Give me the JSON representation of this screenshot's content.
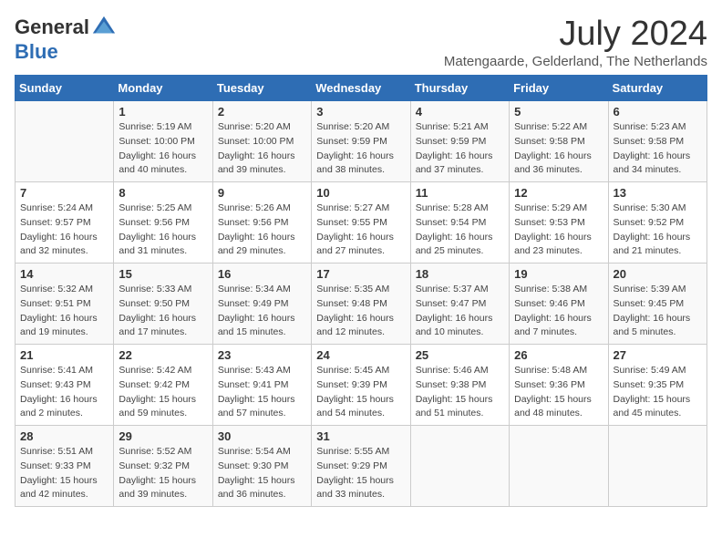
{
  "logo": {
    "general": "General",
    "blue": "Blue"
  },
  "title": "July 2024",
  "location": "Matengaarde, Gelderland, The Netherlands",
  "days_of_week": [
    "Sunday",
    "Monday",
    "Tuesday",
    "Wednesday",
    "Thursday",
    "Friday",
    "Saturday"
  ],
  "weeks": [
    [
      {
        "day": "",
        "info": ""
      },
      {
        "day": "1",
        "info": "Sunrise: 5:19 AM\nSunset: 10:00 PM\nDaylight: 16 hours\nand 40 minutes."
      },
      {
        "day": "2",
        "info": "Sunrise: 5:20 AM\nSunset: 10:00 PM\nDaylight: 16 hours\nand 39 minutes."
      },
      {
        "day": "3",
        "info": "Sunrise: 5:20 AM\nSunset: 9:59 PM\nDaylight: 16 hours\nand 38 minutes."
      },
      {
        "day": "4",
        "info": "Sunrise: 5:21 AM\nSunset: 9:59 PM\nDaylight: 16 hours\nand 37 minutes."
      },
      {
        "day": "5",
        "info": "Sunrise: 5:22 AM\nSunset: 9:58 PM\nDaylight: 16 hours\nand 36 minutes."
      },
      {
        "day": "6",
        "info": "Sunrise: 5:23 AM\nSunset: 9:58 PM\nDaylight: 16 hours\nand 34 minutes."
      }
    ],
    [
      {
        "day": "7",
        "info": "Sunrise: 5:24 AM\nSunset: 9:57 PM\nDaylight: 16 hours\nand 32 minutes."
      },
      {
        "day": "8",
        "info": "Sunrise: 5:25 AM\nSunset: 9:56 PM\nDaylight: 16 hours\nand 31 minutes."
      },
      {
        "day": "9",
        "info": "Sunrise: 5:26 AM\nSunset: 9:56 PM\nDaylight: 16 hours\nand 29 minutes."
      },
      {
        "day": "10",
        "info": "Sunrise: 5:27 AM\nSunset: 9:55 PM\nDaylight: 16 hours\nand 27 minutes."
      },
      {
        "day": "11",
        "info": "Sunrise: 5:28 AM\nSunset: 9:54 PM\nDaylight: 16 hours\nand 25 minutes."
      },
      {
        "day": "12",
        "info": "Sunrise: 5:29 AM\nSunset: 9:53 PM\nDaylight: 16 hours\nand 23 minutes."
      },
      {
        "day": "13",
        "info": "Sunrise: 5:30 AM\nSunset: 9:52 PM\nDaylight: 16 hours\nand 21 minutes."
      }
    ],
    [
      {
        "day": "14",
        "info": "Sunrise: 5:32 AM\nSunset: 9:51 PM\nDaylight: 16 hours\nand 19 minutes."
      },
      {
        "day": "15",
        "info": "Sunrise: 5:33 AM\nSunset: 9:50 PM\nDaylight: 16 hours\nand 17 minutes."
      },
      {
        "day": "16",
        "info": "Sunrise: 5:34 AM\nSunset: 9:49 PM\nDaylight: 16 hours\nand 15 minutes."
      },
      {
        "day": "17",
        "info": "Sunrise: 5:35 AM\nSunset: 9:48 PM\nDaylight: 16 hours\nand 12 minutes."
      },
      {
        "day": "18",
        "info": "Sunrise: 5:37 AM\nSunset: 9:47 PM\nDaylight: 16 hours\nand 10 minutes."
      },
      {
        "day": "19",
        "info": "Sunrise: 5:38 AM\nSunset: 9:46 PM\nDaylight: 16 hours\nand 7 minutes."
      },
      {
        "day": "20",
        "info": "Sunrise: 5:39 AM\nSunset: 9:45 PM\nDaylight: 16 hours\nand 5 minutes."
      }
    ],
    [
      {
        "day": "21",
        "info": "Sunrise: 5:41 AM\nSunset: 9:43 PM\nDaylight: 16 hours\nand 2 minutes."
      },
      {
        "day": "22",
        "info": "Sunrise: 5:42 AM\nSunset: 9:42 PM\nDaylight: 15 hours\nand 59 minutes."
      },
      {
        "day": "23",
        "info": "Sunrise: 5:43 AM\nSunset: 9:41 PM\nDaylight: 15 hours\nand 57 minutes."
      },
      {
        "day": "24",
        "info": "Sunrise: 5:45 AM\nSunset: 9:39 PM\nDaylight: 15 hours\nand 54 minutes."
      },
      {
        "day": "25",
        "info": "Sunrise: 5:46 AM\nSunset: 9:38 PM\nDaylight: 15 hours\nand 51 minutes."
      },
      {
        "day": "26",
        "info": "Sunrise: 5:48 AM\nSunset: 9:36 PM\nDaylight: 15 hours\nand 48 minutes."
      },
      {
        "day": "27",
        "info": "Sunrise: 5:49 AM\nSunset: 9:35 PM\nDaylight: 15 hours\nand 45 minutes."
      }
    ],
    [
      {
        "day": "28",
        "info": "Sunrise: 5:51 AM\nSunset: 9:33 PM\nDaylight: 15 hours\nand 42 minutes."
      },
      {
        "day": "29",
        "info": "Sunrise: 5:52 AM\nSunset: 9:32 PM\nDaylight: 15 hours\nand 39 minutes."
      },
      {
        "day": "30",
        "info": "Sunrise: 5:54 AM\nSunset: 9:30 PM\nDaylight: 15 hours\nand 36 minutes."
      },
      {
        "day": "31",
        "info": "Sunrise: 5:55 AM\nSunset: 9:29 PM\nDaylight: 15 hours\nand 33 minutes."
      },
      {
        "day": "",
        "info": ""
      },
      {
        "day": "",
        "info": ""
      },
      {
        "day": "",
        "info": ""
      }
    ]
  ]
}
